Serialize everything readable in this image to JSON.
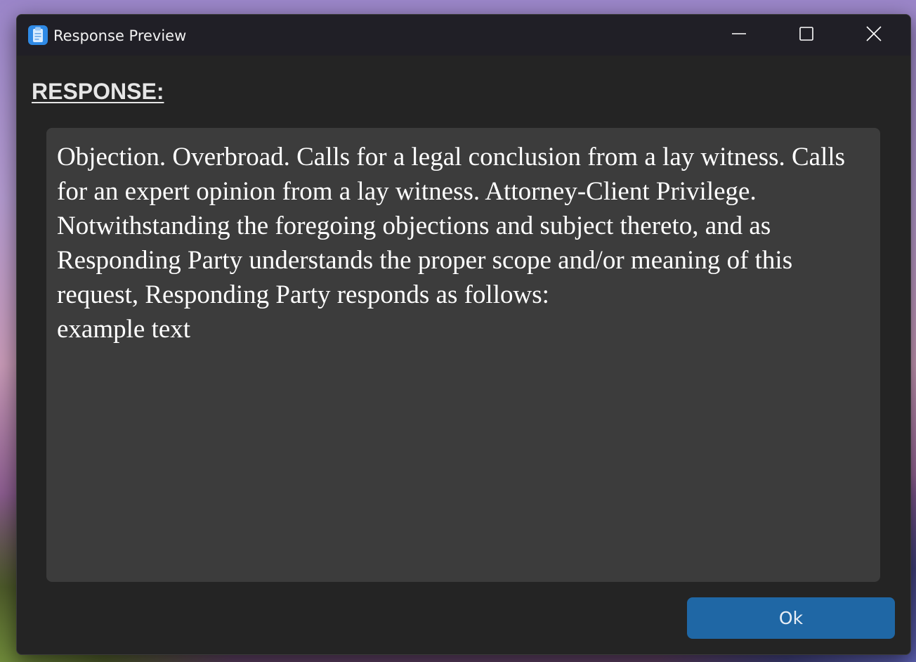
{
  "window": {
    "title": "Response Preview",
    "app_icon": "clipboard-icon",
    "controls": {
      "minimize_icon": "minimize-icon",
      "maximize_icon": "maximize-icon",
      "close_icon": "close-icon"
    }
  },
  "main": {
    "heading": "RESPONSE:",
    "response_text": "Objection. Overbroad. Calls for a legal conclusion from a lay witness. Calls for an expert opinion from a lay witness. Attorney-Client Privilege.  Notwithstanding the foregoing objections and subject thereto, and as Responding Party understands the proper scope and/or meaning of this request, Responding Party responds as follows:\nexample text"
  },
  "footer": {
    "ok_label": "Ok"
  },
  "colors": {
    "window_bg": "#242424",
    "titlebar_bg": "#201f26",
    "textarea_bg": "#3c3c3c",
    "button_accent": "#1f67a5"
  }
}
